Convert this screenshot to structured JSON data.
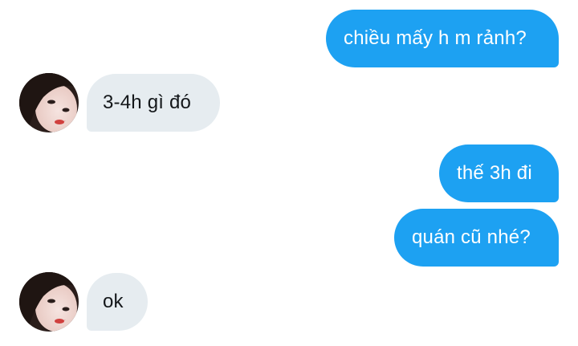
{
  "messages": [
    {
      "direction": "outgoing",
      "text": "chiều mấy h m rảnh?"
    },
    {
      "direction": "incoming",
      "text": "3-4h gì đó"
    },
    {
      "direction": "outgoing",
      "text": "thế 3h đi"
    },
    {
      "direction": "outgoing",
      "text": "quán cũ nhé?"
    },
    {
      "direction": "incoming",
      "text": "ok"
    }
  ],
  "colors": {
    "outgoing_bubble": "#1da1f2",
    "incoming_bubble": "#e6ecf0",
    "outgoing_text": "#ffffff",
    "incoming_text": "#14171a"
  },
  "avatar_icon": "user-avatar-photo"
}
